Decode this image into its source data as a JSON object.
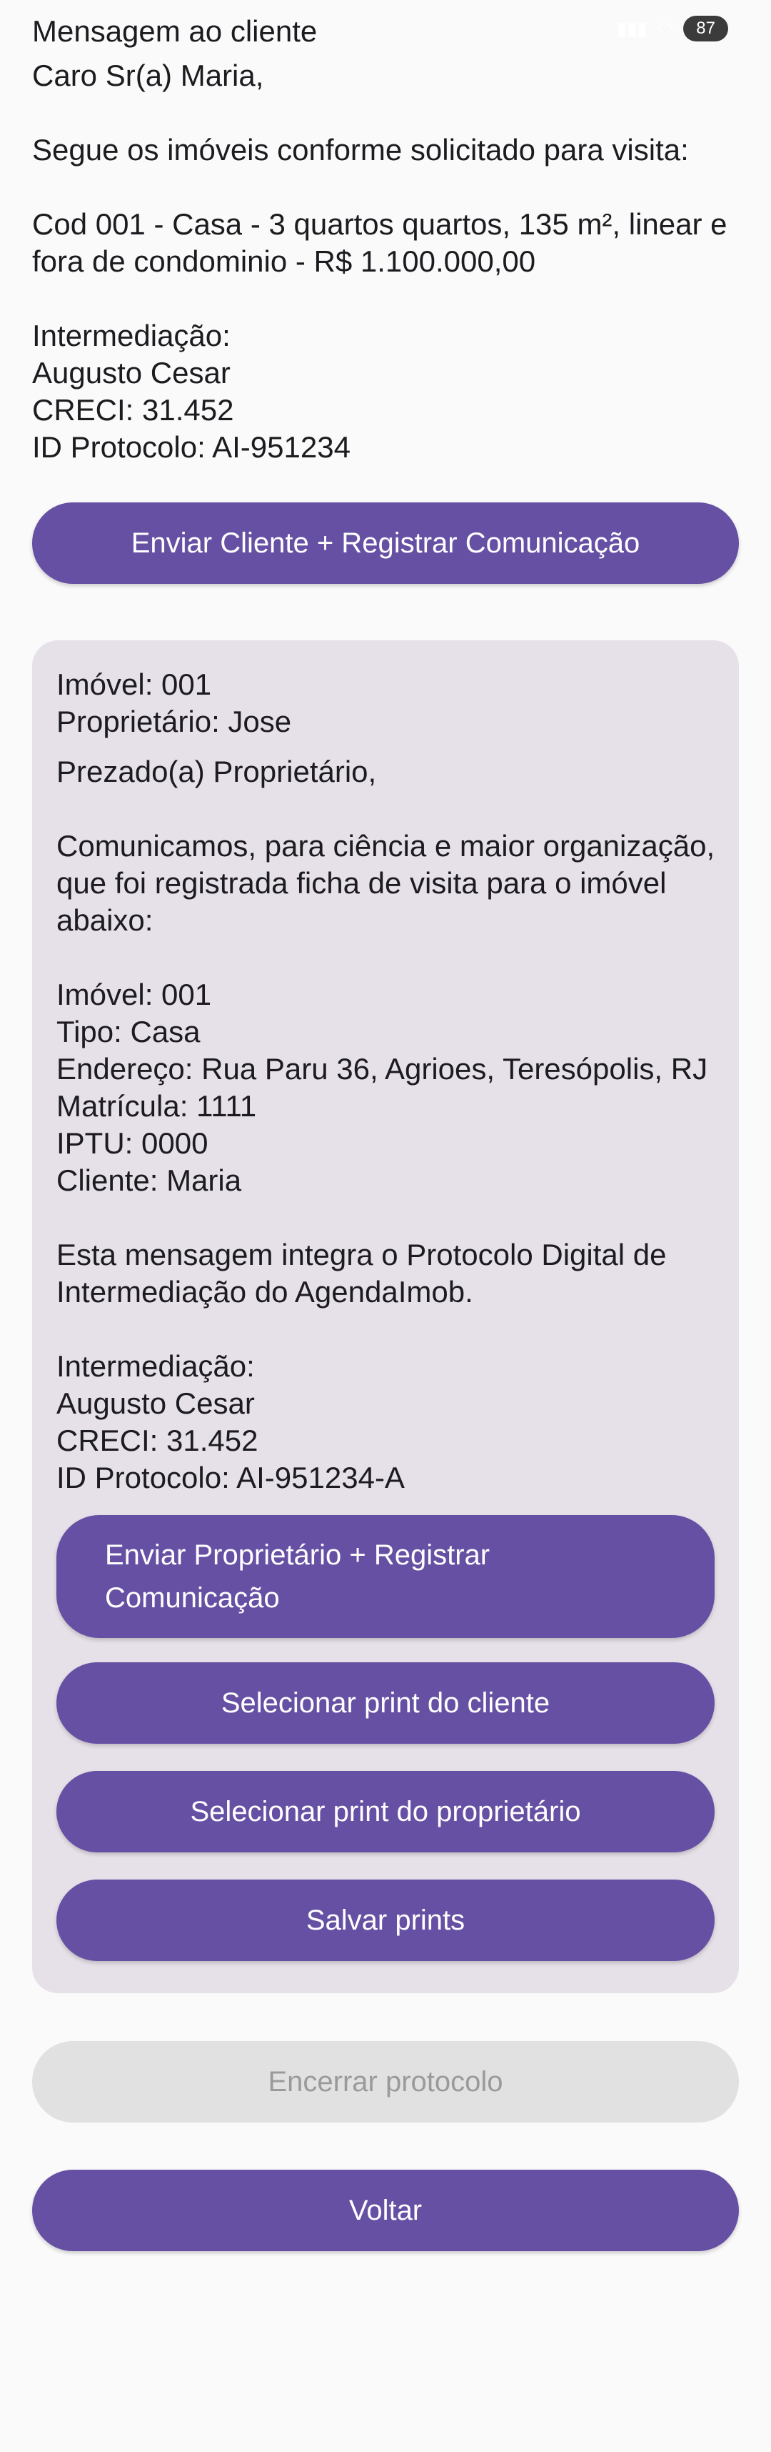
{
  "header": {
    "title": "Mensagem ao cliente",
    "battery": "87"
  },
  "client_message": {
    "text": "Caro Sr(a) Maria,\n\nSegue os imóveis conforme solicitado para visita:\n\nCod 001 - Casa - 3 quartos quartos, 135 m², linear e fora de condominio - R$ 1.100.000,00\n\nIntermediação:\nAugusto Cesar\nCRECI: 31.452\nID Protocolo: AI-951234"
  },
  "buttons": {
    "send_client": "Enviar Cliente + Registrar Comunicação",
    "send_owner": "Enviar Proprietário + Registrar\nComunicação",
    "select_client_print": "Selecionar print do cliente",
    "select_owner_print": "Selecionar print do proprietário",
    "save_prints": "Salvar prints",
    "close_protocol": "Encerrar protocolo",
    "back": "Voltar"
  },
  "owner_card": {
    "property_header": "Imóvel: 001\nProprietário: Jose",
    "message": "Prezado(a) Proprietário,\n\nComunicamos, para ciência e maior organização, que foi registrada ficha de visita para o imóvel abaixo:\n\nImóvel: 001\nTipo: Casa\nEndereço: Rua Paru 36, Agrioes, Teresópolis, RJ\nMatrícula: 1111\nIPTU: 0000\nCliente: Maria\n\nEsta mensagem integra o Protocolo Digital de Intermediação do AgendaImob.\n\nIntermediação:\nAugusto Cesar\nCRECI: 31.452\nID Protocolo: AI-951234-A"
  },
  "colors": {
    "primary": "#6650a4",
    "card_bg": "#e6e1e8",
    "disabled_bg": "#e1e1e1",
    "disabled_text": "#9a9a9a"
  }
}
